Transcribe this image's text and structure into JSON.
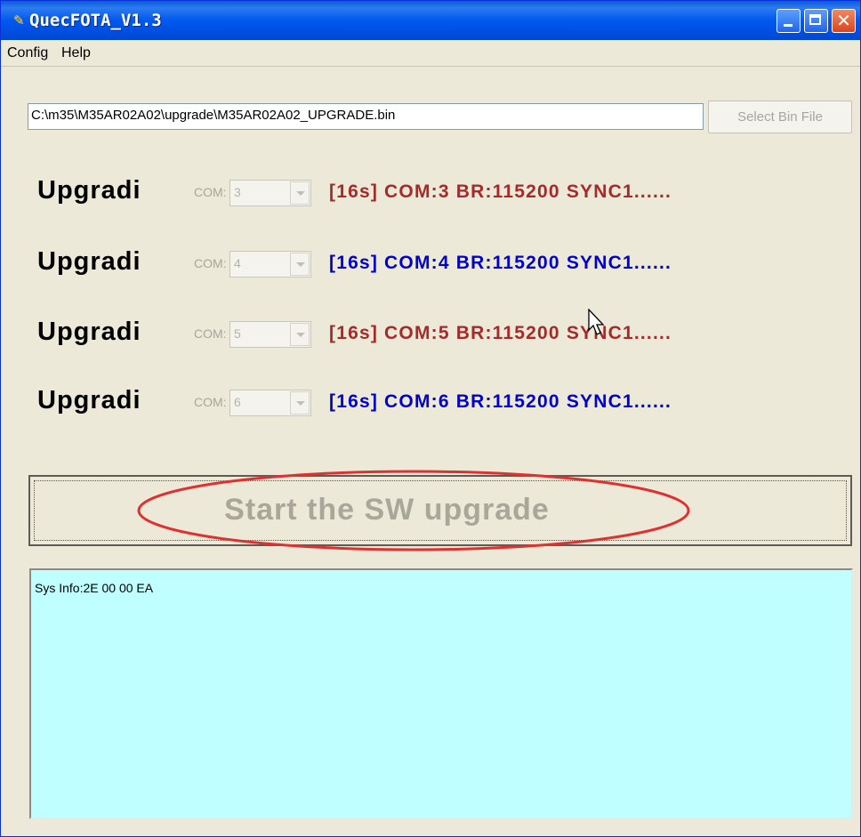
{
  "window": {
    "title": "QuecFOTA_V1.3"
  },
  "menu": {
    "items": [
      "Config",
      "Help"
    ]
  },
  "file": {
    "path": "C:\\m35\\M35AR02A02\\upgrade\\M35AR02A02_UPGRADE.bin",
    "select_button": "Select Bin File"
  },
  "com_label": "COM:",
  "ports": [
    {
      "label": "Upgradi",
      "com": "3",
      "status": "[16s] COM:3 BR:115200 SYNC1......",
      "color": "red"
    },
    {
      "label": "Upgradi",
      "com": "4",
      "status": "[16s] COM:4 BR:115200 SYNC1......",
      "color": "blue"
    },
    {
      "label": "Upgradi",
      "com": "5",
      "status": "[16s] COM:5 BR:115200 SYNC1......",
      "color": "red"
    },
    {
      "label": "Upgradi",
      "com": "6",
      "status": "[16s] COM:6 BR:115200 SYNC1......",
      "color": "blue"
    }
  ],
  "start_button": {
    "label": "Start the SW upgrade"
  },
  "log": {
    "text": "Sys Info:2E 00 00 EA"
  },
  "colors": {
    "status_red": "#a52a2a",
    "status_blue": "#0000cd",
    "log_bg": "#c0ffff",
    "highlight": "#e03030"
  }
}
